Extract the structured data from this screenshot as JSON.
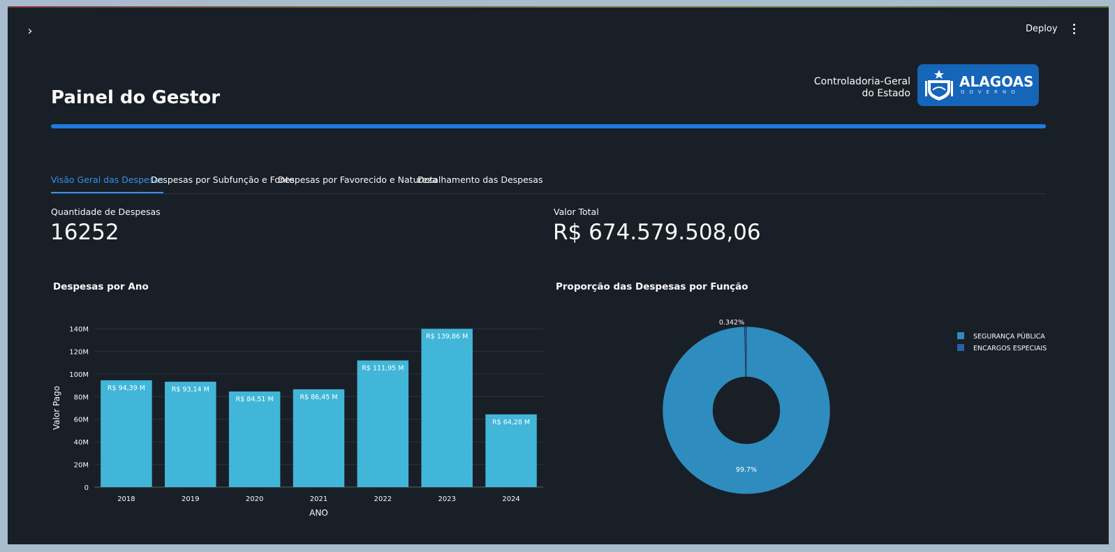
{
  "header": {
    "deploy_label": "Deploy",
    "page_title": "Painel do Gestor",
    "org_line1": "Controladoria-Geral",
    "org_line2": "do Estado",
    "logo_text": "ALAGOAS",
    "logo_subtext": "GOVERNO"
  },
  "tabs": [
    {
      "label": "Visão Geral das Despesas",
      "active": true
    },
    {
      "label": "Despesas por Subfunção e Fonte",
      "active": false
    },
    {
      "label": "Despesas por Favorecido e Natureza",
      "active": false
    },
    {
      "label": "Detalhamento das Despesas",
      "active": false
    }
  ],
  "metrics": {
    "count_label": "Quantidade de Despesas",
    "count_value": "16252",
    "total_label": "Valor Total",
    "total_value": "R$ 674.579.508,06"
  },
  "colors": {
    "accent": "#1b7de0",
    "bar": "#41b6d8",
    "pie_main": "#2e8cbf",
    "pie_small": "#2c5fa3",
    "background": "#191f27"
  },
  "chart_data": [
    {
      "type": "bar",
      "title": "Despesas por Ano",
      "xlabel": "ANO",
      "ylabel": "Valor Pago",
      "categories": [
        "2018",
        "2019",
        "2020",
        "2021",
        "2022",
        "2023",
        "2024"
      ],
      "values": [
        94.39,
        93.14,
        84.51,
        86.45,
        111.95,
        139.86,
        64.28
      ],
      "value_unit": "M",
      "data_labels": [
        "R$ 94,39 M",
        "R$ 93,14 M",
        "R$ 84,51 M",
        "R$ 86,45 M",
        "R$ 111,95 M",
        "R$ 139,86 M",
        "R$ 64,28 M"
      ],
      "ylim": [
        0,
        140
      ],
      "yticks": [
        "0",
        "20M",
        "40M",
        "60M",
        "80M",
        "100M",
        "120M",
        "140M"
      ],
      "grid": true
    },
    {
      "type": "pie",
      "title": "Proporção das Despesas por Função",
      "hole": true,
      "labels": [
        "SEGURANÇA PÚBLICA",
        "ENCARGOS ESPECIAIS"
      ],
      "values": [
        99.658,
        0.342
      ],
      "pct_labels": [
        "99.7%",
        "0.342%"
      ],
      "legend": "top-right"
    }
  ]
}
